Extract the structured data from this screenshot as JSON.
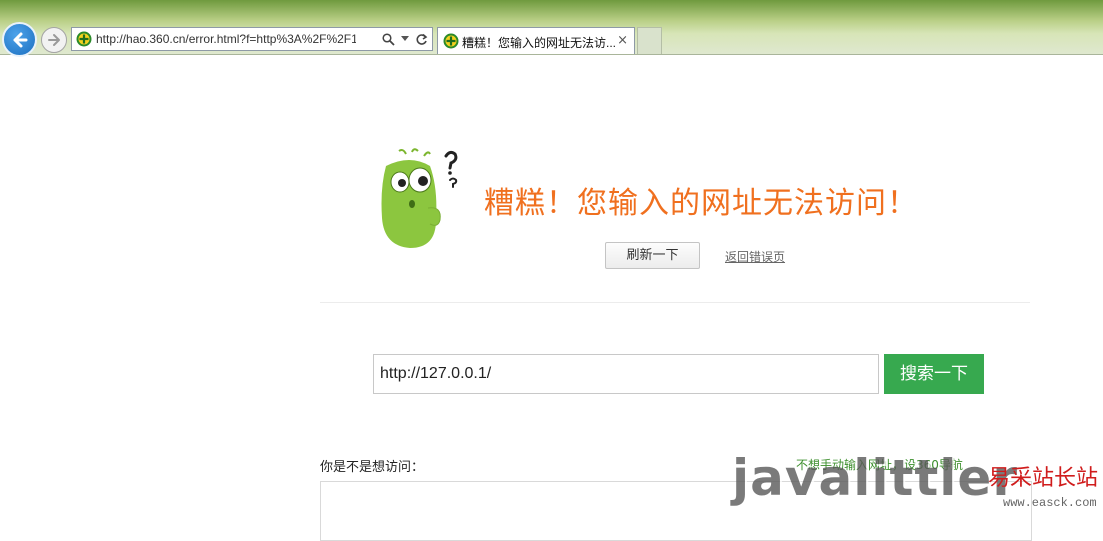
{
  "browser": {
    "address_url": "http://hao.360.cn/error.html?f=http%3A%2F%2F1",
    "tab_title": "糟糕！您输入的网址无法访...",
    "tab_close": "×"
  },
  "error": {
    "headline": "糟糕！您输入的网址无法访问！",
    "refresh_label": "刷新一下",
    "back_label": "返回错误页"
  },
  "search": {
    "value": "http://127.0.0.1/",
    "button_label": "搜索一下"
  },
  "suggest": {
    "label": "你是不是想访问：",
    "note": "不想手动输入网址，设360导航"
  },
  "watermark": {
    "brand": "javalittler",
    "cn": "易采站长站",
    "url": "www.easck.com"
  },
  "colors": {
    "headline": "#f0701f",
    "search_button": "#37a94f",
    "mascot": "#8cc63f"
  }
}
